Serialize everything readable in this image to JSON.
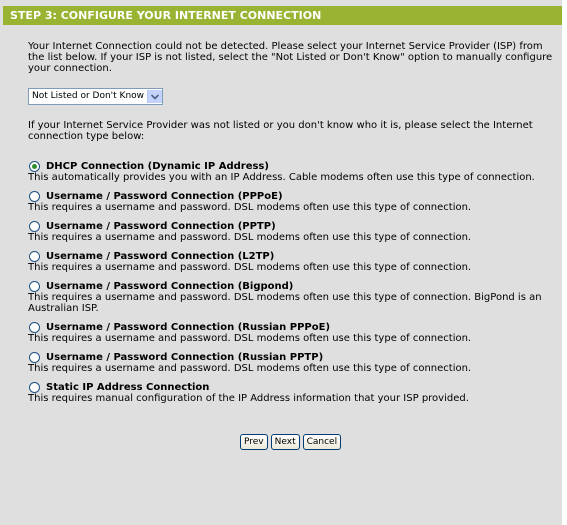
{
  "header": {
    "title": "STEP 3: CONFIGURE YOUR INTERNET CONNECTION"
  },
  "intro": "Your Internet Connection could not be detected. Please select your Internet Service Provider (ISP) from the list below. If your ISP is not listed, select the \"Not Listed or Don't Know\" option to manually configure your connection.",
  "isp_select": {
    "selected": "Not Listed or Don't Know"
  },
  "prompt": "If your Internet Service Provider was not listed or you don't know who it is, please select the Internet connection type below:",
  "options": [
    {
      "label": "DHCP Connection (Dynamic IP Address)",
      "desc": "This automatically provides you with an IP Address. Cable modems often use this type of connection.",
      "checked": true
    },
    {
      "label": "Username / Password Connection (PPPoE)",
      "desc": "This requires a username and password. DSL modems often use this type of connection.",
      "checked": false
    },
    {
      "label": "Username / Password Connection (PPTP)",
      "desc": "This requires a username and password. DSL modems often use this type of connection.",
      "checked": false
    },
    {
      "label": "Username / Password Connection (L2TP)",
      "desc": "This requires a username and password. DSL modems often use this type of connection.",
      "checked": false
    },
    {
      "label": "Username / Password Connection (Bigpond)",
      "desc": "This requires a username and password. DSL modems often use this type of connection. BigPond is an Australian ISP.",
      "checked": false
    },
    {
      "label": "Username / Password Connection (Russian PPPoE)",
      "desc": "This requires a username and password. DSL modems often use this type of connection.",
      "checked": false
    },
    {
      "label": "Username / Password Connection (Russian PPTP)",
      "desc": "This requires a username and password. DSL modems often use this type of connection.",
      "checked": false
    },
    {
      "label": "Static IP Address Connection",
      "desc": "This requires manual configuration of the IP Address information that your ISP provided.",
      "checked": false
    }
  ],
  "buttons": {
    "prev": "Prev",
    "next": "Next",
    "cancel": "Cancel"
  },
  "colors": {
    "header_bg": "#99b332",
    "panel_bg": "#dfdfdf",
    "header_text": "#ffffff"
  }
}
